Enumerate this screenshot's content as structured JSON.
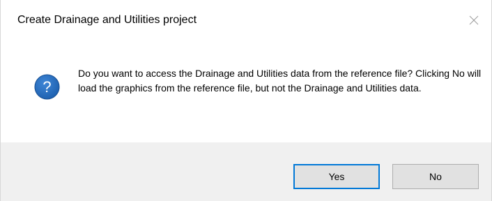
{
  "dialog": {
    "title": "Create Drainage and Utilities project",
    "message": "Do you want to access the Drainage and Utilities data from the reference file? Clicking No will load the graphics from the reference file, but not the Drainage and Utilities data.",
    "icon": "question-icon",
    "buttons": {
      "yes_label": "Yes",
      "no_label": "No"
    }
  },
  "colors": {
    "icon_fill": "#1c5fae",
    "focus_border": "#0078d7",
    "button_bar": "#f0f0f0"
  }
}
